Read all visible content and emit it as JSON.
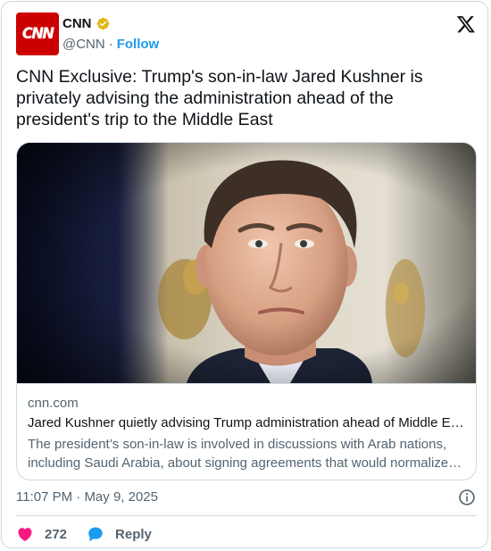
{
  "account": {
    "avatar_text": "CNN",
    "display_name": "CNN",
    "handle": "@CNN",
    "separator": "·",
    "follow_label": "Follow",
    "brand_color": "#cc0000",
    "verified_color": "#e2b719"
  },
  "tweet": {
    "text": "CNN Exclusive: Trump's son-in-law Jared Kushner is privately advising the administration ahead of the president's trip to the Middle East"
  },
  "link_card": {
    "domain": "cnn.com",
    "title": "Jared Kushner quietly advising Trump administration ahead of Middle East trip",
    "description": "The president’s son-in-law is involved in discussions with Arab nations, including Saudi Arabia, about signing agreements that would normalize relations with Israel"
  },
  "meta": {
    "time": "11:07 PM",
    "separator": "·",
    "date": "May 9, 2025"
  },
  "actions": {
    "like_count": "272",
    "reply_label": "Reply",
    "like_color": "#f91880",
    "reply_color": "#1d9bf0"
  },
  "icons": [
    "x-logo-icon",
    "verified-badge-icon",
    "info-icon",
    "heart-icon",
    "reply-bubble-icon"
  ]
}
